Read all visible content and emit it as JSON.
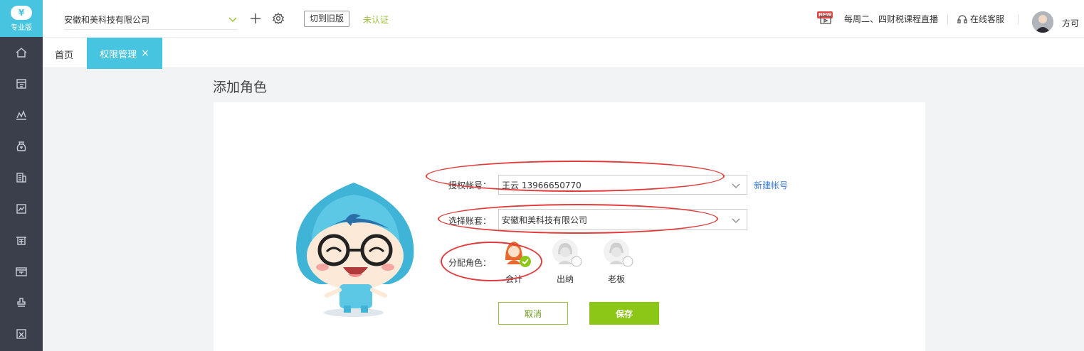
{
  "sidebar": {
    "logo_text": "专业版",
    "logo_symbol": "¥",
    "items": [
      {
        "icon": "home-icon"
      },
      {
        "icon": "voucher-icon"
      },
      {
        "icon": "chart-icon"
      },
      {
        "icon": "money-bag-icon"
      },
      {
        "icon": "building-icon"
      },
      {
        "icon": "report-icon"
      },
      {
        "icon": "tax-icon"
      },
      {
        "icon": "asset-icon"
      },
      {
        "icon": "stamp-icon"
      },
      {
        "icon": "settings-doc-icon"
      }
    ]
  },
  "topbar": {
    "company": "安徽和美科技有限公司",
    "switch_old": "切到旧版",
    "unverified": "未认证",
    "new_badge": "NEW",
    "live_course": "每周二、四财税课程直播",
    "service": "在线客服",
    "user_name": "方可"
  },
  "tabs": {
    "home": "首页",
    "active": "权限管理",
    "close": "×"
  },
  "page": {
    "title": "添加角色"
  },
  "form": {
    "account_label": "授权帐号：",
    "account_value": "王云 13966650770",
    "new_account_link": "新建帐号",
    "book_label": "选择账套：",
    "book_value": "安徽和美科技有限公司",
    "role_label": "分配角色：",
    "roles": [
      {
        "label": "会计",
        "selected": true
      },
      {
        "label": "出纳",
        "selected": false
      },
      {
        "label": "老板",
        "selected": false
      }
    ],
    "cancel": "取消",
    "save": "保存"
  },
  "colors": {
    "sidebar": "#3a3f4b",
    "accent": "#47c4e0",
    "save_green": "#8cc617",
    "annotation_red": "#e23b3b"
  }
}
